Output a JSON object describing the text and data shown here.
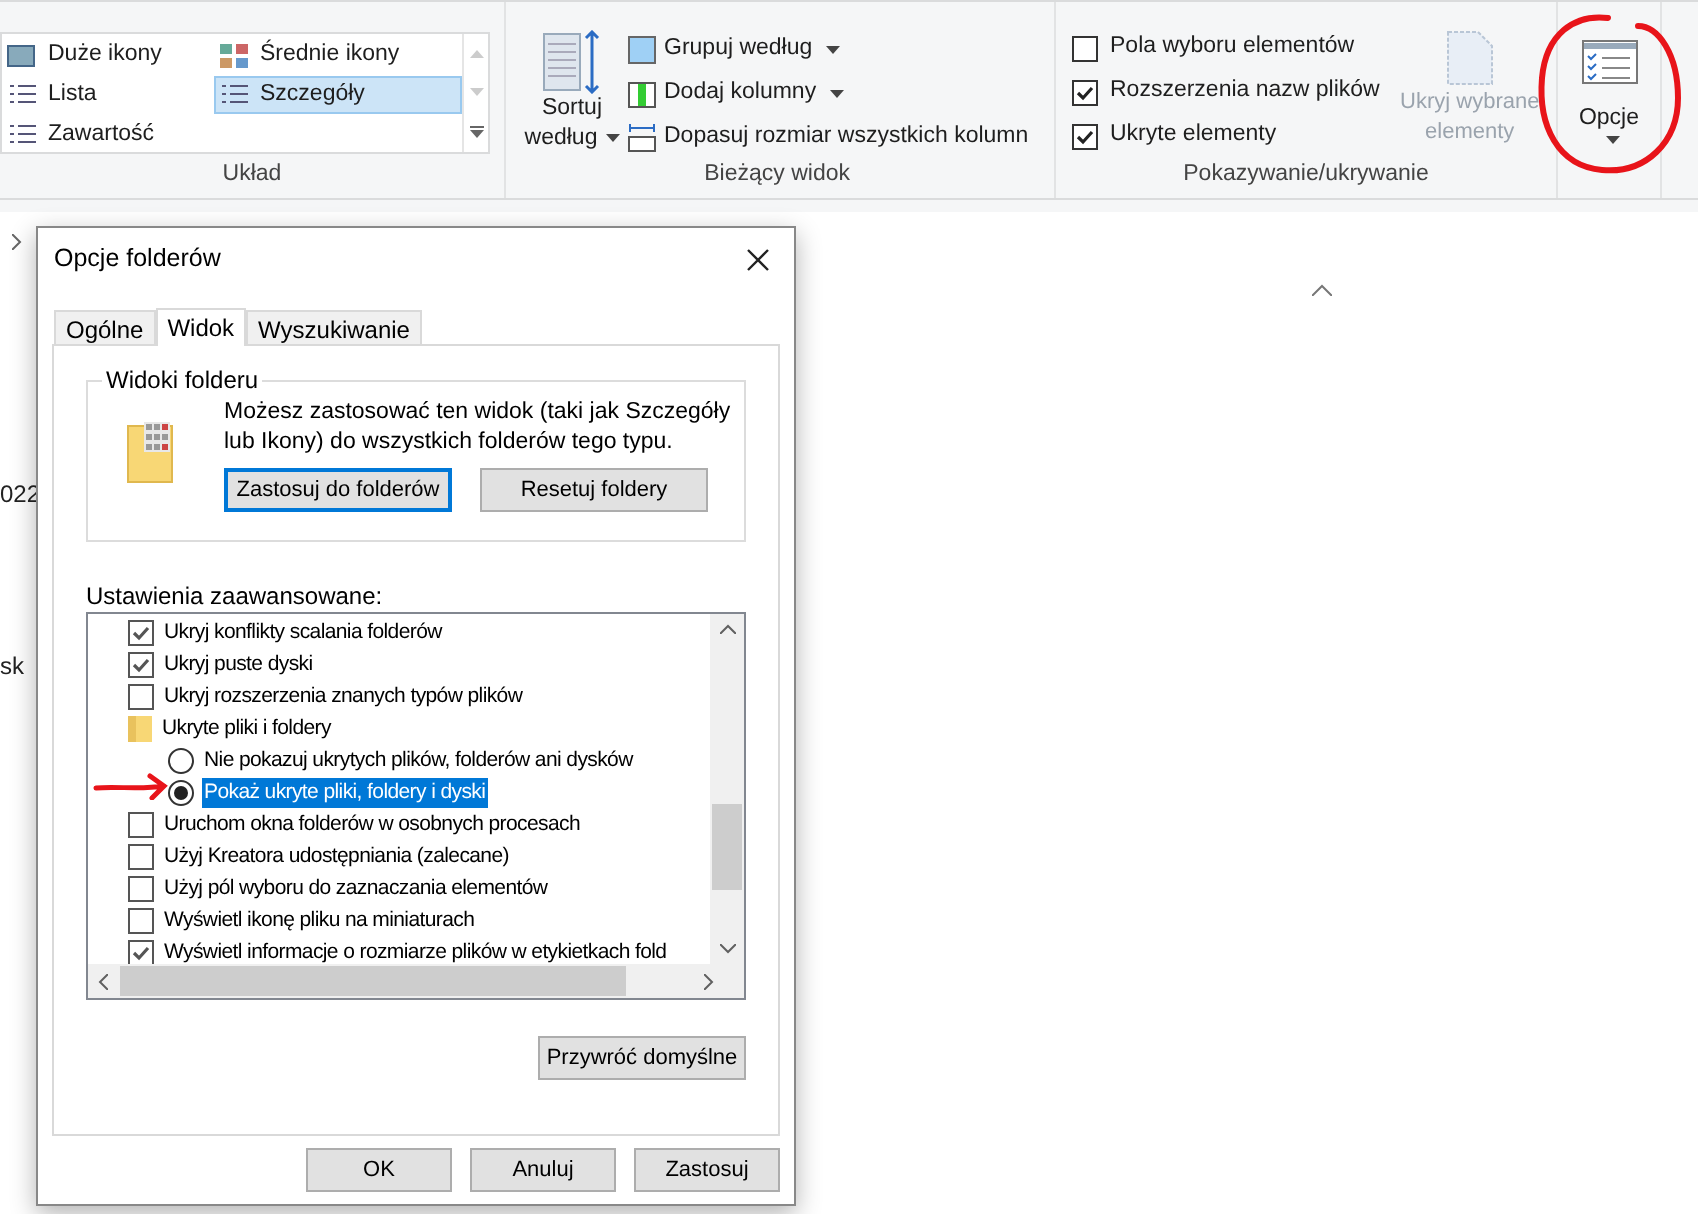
{
  "ribbon": {
    "layout": {
      "items": [
        {
          "label": "Duże ikony",
          "selected": false
        },
        {
          "label": "Średnie ikony",
          "selected": false
        },
        {
          "label": "Lista",
          "selected": false
        },
        {
          "label": "Szczegóły",
          "selected": true
        },
        {
          "label": "Zawartość",
          "selected": false
        }
      ],
      "label": "Układ"
    },
    "current_view": {
      "sort": [
        "Sortuj",
        "według"
      ],
      "commands": [
        {
          "label": "Grupuj według",
          "dropdown": true
        },
        {
          "label": "Dodaj kolumny",
          "dropdown": true
        },
        {
          "label": "Dopasuj rozmiar wszystkich kolumn",
          "dropdown": false
        }
      ],
      "label": "Bieżący widok"
    },
    "show_hide": {
      "checkboxes": [
        {
          "label": "Pola wyboru elementów",
          "checked": false
        },
        {
          "label": "Rozszerzenia nazw plików",
          "checked": true
        },
        {
          "label": "Ukryte elementy",
          "checked": true
        }
      ],
      "hide_selected": {
        "label": [
          "Ukryj wybrane",
          "elementy"
        ],
        "disabled": true
      },
      "label": "Pokazywanie/ukrywanie"
    },
    "options": {
      "label": "Opcje"
    }
  },
  "background_text": [
    "022",
    "sk"
  ],
  "dialog": {
    "title": "Opcje folderów",
    "tabs": [
      {
        "label": "Ogólne",
        "selected": false
      },
      {
        "label": "Widok",
        "selected": true
      },
      {
        "label": "Wyszukiwanie",
        "selected": false
      }
    ],
    "folder_views": {
      "title": "Widoki folderu",
      "description": "Możesz zastosować ten widok (taki jak Szczegóły lub Ikony) do wszystkich folderów tego typu.",
      "buttons": [
        {
          "label": "Zastosuj do folderów",
          "focused": true
        },
        {
          "label": "Resetuj foldery",
          "focused": false
        }
      ]
    },
    "advanced_label": "Ustawienia zaawansowane:",
    "advanced": [
      {
        "kind": "checkbox",
        "label": "Ukryj konflikty scalania folderów",
        "checked": true,
        "selected": false
      },
      {
        "kind": "checkbox",
        "label": "Ukryj puste dyski",
        "checked": true,
        "selected": false
      },
      {
        "kind": "checkbox",
        "label": "Ukryj rozszerzenia znanych typów plików",
        "checked": false,
        "selected": false
      },
      {
        "kind": "folder",
        "label": "Ukryte pliki i foldery",
        "selected": false,
        "children": [
          {
            "kind": "radio",
            "label": "Nie pokazuj ukrytych plików, folderów ani dysków",
            "checked": false,
            "selected": false
          },
          {
            "kind": "radio",
            "label": "Pokaż ukryte pliki, foldery i dyski",
            "checked": true,
            "selected": true
          }
        ]
      },
      {
        "kind": "checkbox",
        "label": "Uruchom okna folderów w osobnych procesach",
        "checked": false,
        "selected": false
      },
      {
        "kind": "checkbox",
        "label": "Użyj Kreatora udostępniania (zalecane)",
        "checked": false,
        "selected": false
      },
      {
        "kind": "checkbox",
        "label": "Użyj pól wyboru do zaznaczania elementów",
        "checked": false,
        "selected": false
      },
      {
        "kind": "checkbox",
        "label": "Wyświetl ikonę pliku na miniaturach",
        "checked": false,
        "selected": false
      },
      {
        "kind": "checkbox",
        "label": "Wyświetl informacje o rozmiarze plików w etykietkach fold",
        "checked": true,
        "selected": false
      }
    ],
    "restore_button": "Przywróć domyślne",
    "buttons": [
      "OK",
      "Anuluj",
      "Zastosuj"
    ]
  }
}
